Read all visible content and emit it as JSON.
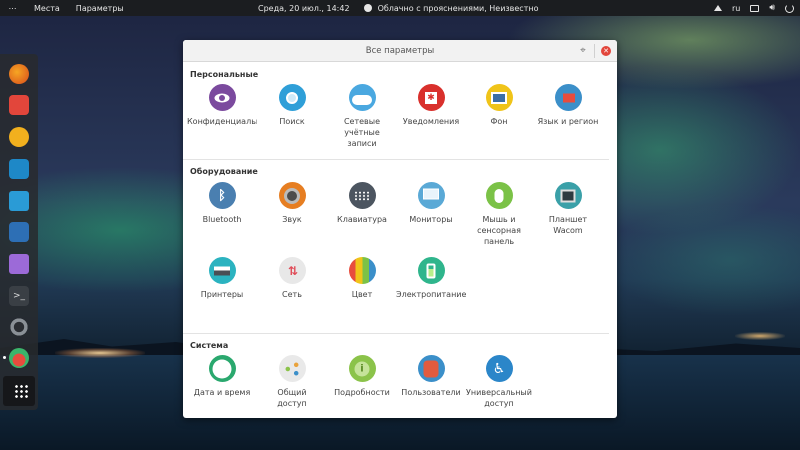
{
  "topbar": {
    "activities": "⋯",
    "places": "Места",
    "app_menu": "Параметры",
    "datetime": "Среда, 20 июл., 14:42",
    "weather": "Облачно с прояснениями, Неизвестно",
    "keyboard_layout": "ru"
  },
  "window": {
    "title": "Все параметры"
  },
  "sections": {
    "personal": {
      "title": "Персональные",
      "items": [
        "Конфиденциальность",
        "Поиск",
        "Сетевые учётные записи",
        "Уведомления",
        "Фон",
        "Язык и регион"
      ]
    },
    "hardware": {
      "title": "Оборудование",
      "items": [
        "Bluetooth",
        "Звук",
        "Клавиатура",
        "Мониторы",
        "Мышь и сенсорная панель",
        "Планшет Wacom",
        "Принтеры",
        "Сеть",
        "Цвет",
        "Электропитание"
      ]
    },
    "system": {
      "title": "Система",
      "items": [
        "Дата и время",
        "Общий доступ",
        "Подробности",
        "Пользователи",
        "Универсальный доступ"
      ]
    }
  },
  "colors": {
    "privacy": "#7b4a9e",
    "search": "#2f9fd8",
    "accounts": "#4aa8e0",
    "notifications": "#d9302c",
    "background": "#f0c419",
    "region": "#3b8fc9",
    "bluetooth": "#4a7fb0",
    "sound": "#e67e22",
    "keyboard": "#4c5560",
    "monitors": "#5aa9d6",
    "mouse": "#7bc247",
    "wacom": "#3aa0a8",
    "printers": "#2bb3c0",
    "network": "#e04c58",
    "power": "#2fb58c",
    "datetime": "#2aa86e",
    "sharing": "#e9e9e9",
    "details": "#8bc34a",
    "users": "#e25b3f",
    "a11y": "#2b86c9"
  }
}
